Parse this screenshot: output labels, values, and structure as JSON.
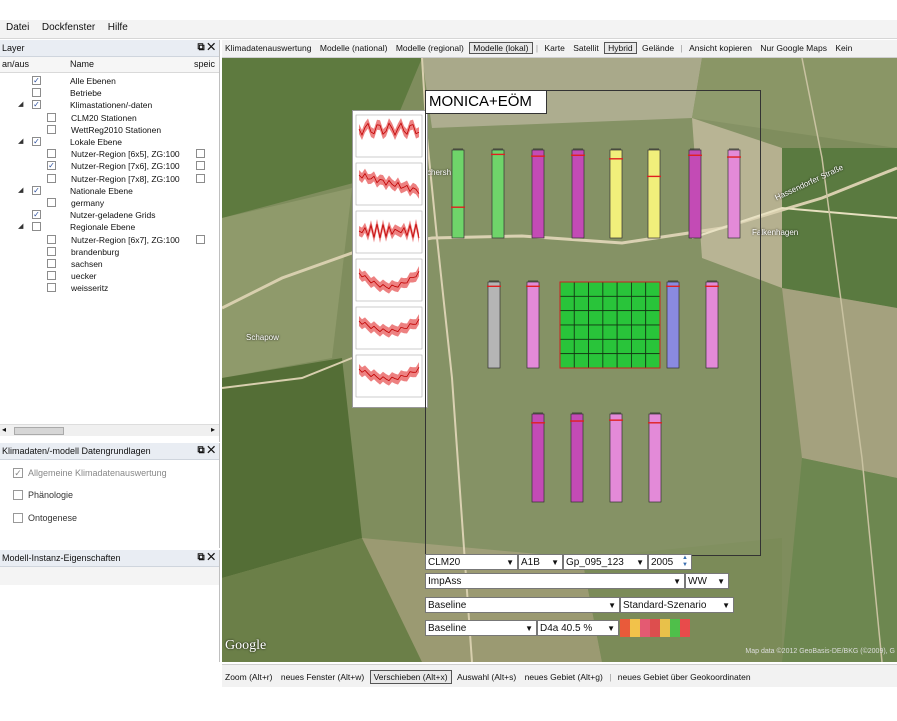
{
  "menu": {
    "items": [
      "Datei",
      "Dockfenster",
      "Hilfe"
    ]
  },
  "layer_panel": {
    "title": "Layer",
    "col_onoff": "an/aus",
    "col_name": "Name",
    "col_store": "speic",
    "rows": [
      {
        "label": "Alle Ebenen",
        "checked": true,
        "indent": 0,
        "expander": ""
      },
      {
        "label": "Betriebe",
        "checked": false,
        "indent": 0,
        "expander": ""
      },
      {
        "label": "Klimastationen/-daten",
        "checked": true,
        "indent": 0,
        "expander": "◢"
      },
      {
        "label": "CLM20 Stationen",
        "checked": false,
        "indent": 1,
        "expander": ""
      },
      {
        "label": "WettReg2010 Stationen",
        "checked": false,
        "indent": 1,
        "expander": ""
      },
      {
        "label": "Lokale Ebene",
        "checked": true,
        "indent": 0,
        "expander": "◢"
      },
      {
        "label": "Nutzer-Region [6x5], ZG:100",
        "checked": false,
        "indent": 1,
        "expander": ""
      },
      {
        "label": "Nutzer-Region [7x6], ZG:100",
        "checked": true,
        "indent": 1,
        "expander": ""
      },
      {
        "label": "Nutzer-Region [7x8], ZG:100",
        "checked": false,
        "indent": 1,
        "expander": ""
      },
      {
        "label": "Nationale Ebene",
        "checked": true,
        "indent": 0,
        "expander": "◢"
      },
      {
        "label": "germany",
        "checked": false,
        "indent": 1,
        "expander": ""
      },
      {
        "label": "Nutzer-geladene Grids",
        "checked": true,
        "indent": 0,
        "expander": ""
      },
      {
        "label": "Regionale Ebene",
        "checked": false,
        "indent": 0,
        "expander": "◢"
      },
      {
        "label": "Nutzer-Region [6x7], ZG:100",
        "checked": false,
        "indent": 1,
        "expander": ""
      },
      {
        "label": "brandenburg",
        "checked": false,
        "indent": 1,
        "expander": ""
      },
      {
        "label": "sachsen",
        "checked": false,
        "indent": 1,
        "expander": ""
      },
      {
        "label": "uecker",
        "checked": false,
        "indent": 1,
        "expander": ""
      },
      {
        "label": "weisseritz",
        "checked": false,
        "indent": 1,
        "expander": ""
      }
    ]
  },
  "klima_panel": {
    "title": "Klimadaten/-modell Datengrundlagen",
    "options": [
      {
        "label": "Allgemeine Klimadatenauswertung",
        "checked": true
      },
      {
        "label": "Phänologie",
        "checked": false
      },
      {
        "label": "Ontogenese",
        "checked": false
      }
    ]
  },
  "model_panel": {
    "title": "Modell-Instanz-Eigenschaften"
  },
  "toolbar": {
    "items": [
      "Klimadatenauswertung",
      "Modelle (national)",
      "Modelle (regional)",
      "Modelle (lokal)",
      "|",
      "Karte",
      "Satellit",
      "Hybrid",
      "Gelände",
      "|",
      "Ansicht kopieren",
      "Nur Google Maps",
      "Kein"
    ],
    "selected": [
      "Modelle (lokal)",
      "Hybrid"
    ]
  },
  "map": {
    "overlay_title": "MONICA+EÖM",
    "place_labels": [
      "Schapow",
      "Falkenhagen",
      "Hassendorfer Straße",
      "chersh"
    ],
    "google_logo": "Google",
    "attribution": "Map data ©2012 GeoBasis-DE/BKG (©2009), G"
  },
  "controls": {
    "climate_model": "CLM20",
    "scenario": "A1B",
    "grid": "Gp_095_123",
    "year": "2005",
    "model": "ImpAss",
    "crop": "WW",
    "row3_left": "Baseline",
    "row3_right": "Standard-Szenario",
    "row4_left": "Baseline",
    "row4_right": "D4a 40.5 %"
  },
  "statusbar": {
    "items": [
      "Zoom (Alt+r)",
      "neues Fenster (Alt+w)",
      "Verschieben (Alt+x)",
      "Auswahl (Alt+s)",
      "neues Gebiet (Alt+g)",
      "|",
      "neues Gebiet über Geokoordinaten"
    ],
    "selected": "Verschieben (Alt+x)"
  },
  "colors": {
    "green": "#6fd46a",
    "magenta": "#c34bb5",
    "yellow": "#f1ef7b",
    "pink": "#e38ad8",
    "grey": "#b5b5b5",
    "blue": "#8a8ae0",
    "grid": "#29c43a"
  }
}
